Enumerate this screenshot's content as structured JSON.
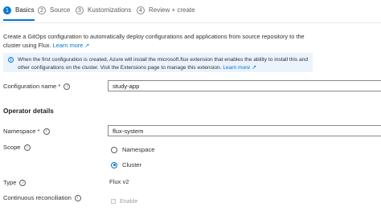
{
  "tabs": [
    {
      "number": "1",
      "label": "Basics"
    },
    {
      "number": "2",
      "label": "Source"
    },
    {
      "number": "3",
      "label": "Kustomizations"
    },
    {
      "number": "4",
      "label": "Review + create"
    }
  ],
  "intro": {
    "text": "Create a GitOps configuration to automatically deploy configurations and applications from source repository to the cluster using Flux.",
    "link": "Learn more"
  },
  "info": {
    "text": "When the first configuration is created, Azure will install the microsoft.flux extension that enables the ability to install this and other configurations on the cluster. Visit the Extensions page to manage this extension.",
    "link": "Learn more"
  },
  "form": {
    "configuration_name": {
      "label": "Configuration name *",
      "value": "study-app"
    },
    "operator_section": "Operator details",
    "namespace": {
      "label": "Namespace *",
      "value": "flux-system"
    },
    "scope": {
      "label": "Scope",
      "options": [
        {
          "label": "Namespace",
          "selected": false
        },
        {
          "label": "Cluster",
          "selected": true
        }
      ]
    },
    "type": {
      "label": "Type",
      "value": "Flux v2"
    },
    "continuous_reconciliation": {
      "label": "Continuous reconciliation",
      "option": "Enable",
      "checked": true,
      "disabled": true
    }
  }
}
